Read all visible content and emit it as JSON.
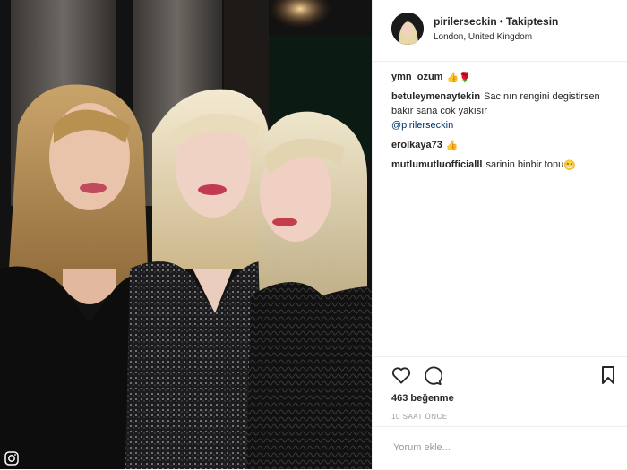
{
  "header": {
    "username": "pirilerseckin",
    "separator": "•",
    "follow_label": "Takiptesin",
    "location": "London, United Kingdom"
  },
  "comments": [
    {
      "user": "ymn_ozum",
      "text": "",
      "emoji": "👍🌹"
    },
    {
      "user": "betuleymenaytekin",
      "text": "Sacının rengini degistirsen bakır sana cok yakısır",
      "mention": "@pirilerseckin"
    },
    {
      "user": "erolkaya73",
      "text": "",
      "emoji": "👍"
    },
    {
      "user": "mutlumutluofficialll",
      "text": "sarinin binbir tonu",
      "emoji": "😁"
    }
  ],
  "actions": {
    "likes": "463 beğenme",
    "timestamp": "10 SAAT ÖNCE"
  },
  "add_comment": {
    "placeholder": "Yorum ekle..."
  },
  "icons": [
    "heart-icon",
    "comment-icon",
    "bookmark-icon",
    "instagram-icon"
  ],
  "colors": {
    "mention": "#003569",
    "text": "#262626",
    "muted": "#999999"
  }
}
